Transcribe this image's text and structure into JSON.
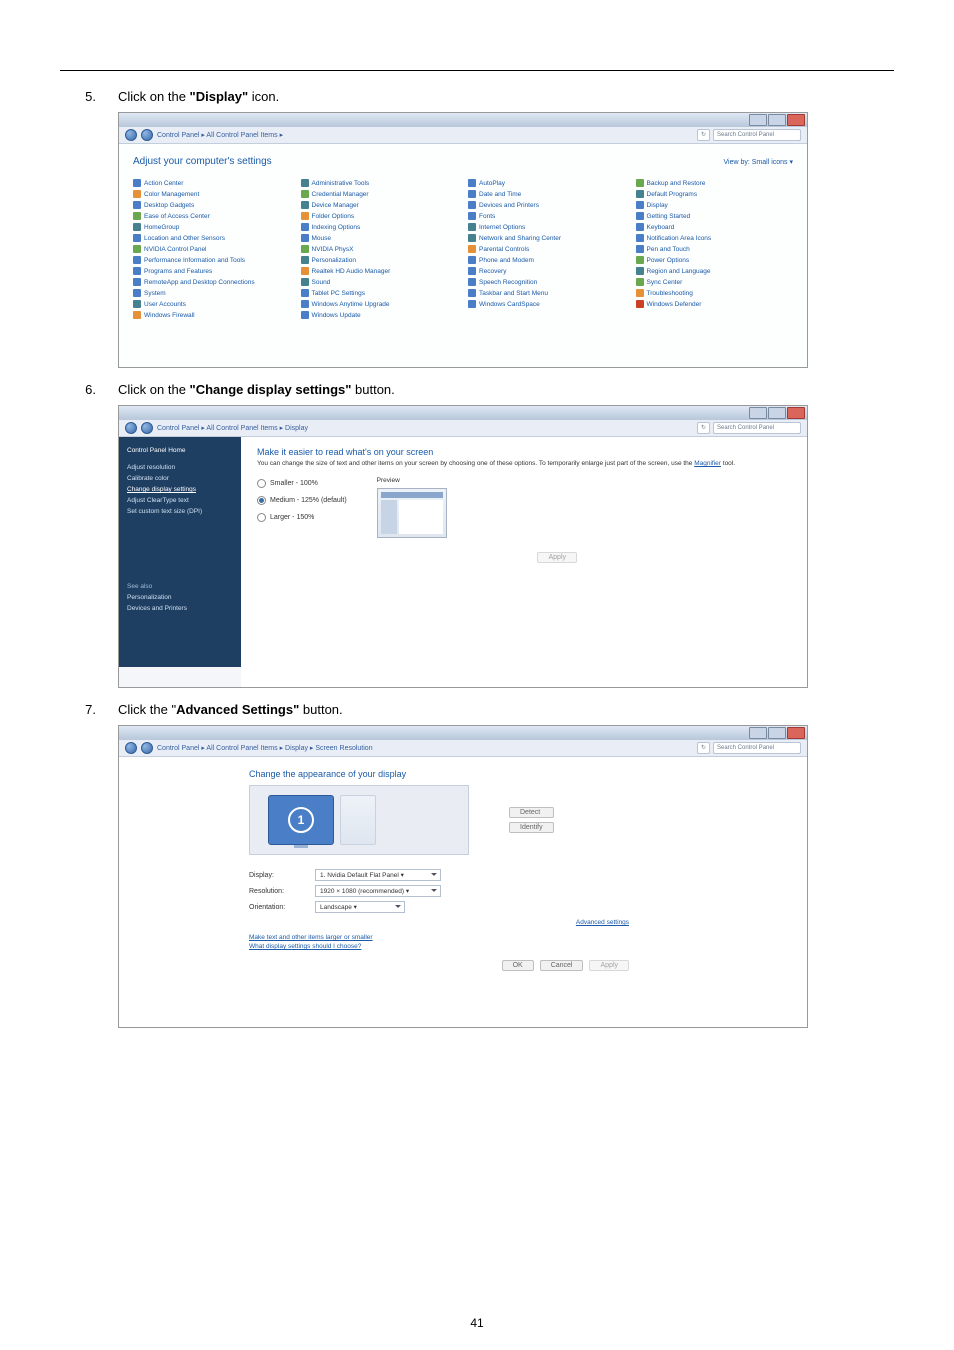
{
  "page_number": "41",
  "steps": {
    "s5": {
      "num": "5.",
      "pre": "Click on the ",
      "bold": "\"Display\"",
      "post": " icon."
    },
    "s6": {
      "num": "6.",
      "pre": "Click on the ",
      "bold": "\"Change display settings\"",
      "post": " button."
    },
    "s7": {
      "num": "7.",
      "pre": "Click the \"",
      "bold": "Advanced Settings\"",
      "post": " button."
    }
  },
  "win_common": {
    "search_placeholder": "Search Control Panel",
    "refresh_pill": "↻"
  },
  "shot1": {
    "breadcrumb": "Control Panel ▸ All Control Panel Items ▸",
    "heading": "Adjust your computer's settings",
    "viewby": "View by:  Small icons ▾",
    "items": [
      [
        {
          "t": "Action Center",
          "c": "blue"
        },
        {
          "t": "Administrative Tools",
          "c": "teal"
        },
        {
          "t": "AutoPlay",
          "c": "blue"
        },
        {
          "t": "Backup and Restore",
          "c": "green"
        }
      ],
      [
        {
          "t": "Color Management",
          "c": "orange"
        },
        {
          "t": "Credential Manager",
          "c": "green"
        },
        {
          "t": "Date and Time",
          "c": "blue"
        },
        {
          "t": "Default Programs",
          "c": "teal"
        }
      ],
      [
        {
          "t": "Desktop Gadgets",
          "c": "blue"
        },
        {
          "t": "Device Manager",
          "c": "teal"
        },
        {
          "t": "Devices and Printers",
          "c": "blue"
        },
        {
          "t": "Display",
          "c": "blue"
        }
      ],
      [
        {
          "t": "Ease of Access Center",
          "c": "green"
        },
        {
          "t": "Folder Options",
          "c": "orange"
        },
        {
          "t": "Fonts",
          "c": "blue"
        },
        {
          "t": "Getting Started",
          "c": "blue"
        }
      ],
      [
        {
          "t": "HomeGroup",
          "c": "teal"
        },
        {
          "t": "Indexing Options",
          "c": "blue"
        },
        {
          "t": "Internet Options",
          "c": "teal"
        },
        {
          "t": "Keyboard",
          "c": "blue"
        }
      ],
      [
        {
          "t": "Location and Other Sensors",
          "c": "blue"
        },
        {
          "t": "Mouse",
          "c": "blue"
        },
        {
          "t": "Network and Sharing Center",
          "c": "teal"
        },
        {
          "t": "Notification Area Icons",
          "c": "blue"
        }
      ],
      [
        {
          "t": "NVIDIA Control Panel",
          "c": "green"
        },
        {
          "t": "NVIDIA PhysX",
          "c": "green"
        },
        {
          "t": "Parental Controls",
          "c": "orange"
        },
        {
          "t": "Pen and Touch",
          "c": "blue"
        }
      ],
      [
        {
          "t": "Performance Information and Tools",
          "c": "blue"
        },
        {
          "t": "Personalization",
          "c": "teal"
        },
        {
          "t": "Phone and Modem",
          "c": "blue"
        },
        {
          "t": "Power Options",
          "c": "green"
        }
      ],
      [
        {
          "t": "Programs and Features",
          "c": "blue"
        },
        {
          "t": "Realtek HD Audio Manager",
          "c": "orange"
        },
        {
          "t": "Recovery",
          "c": "blue"
        },
        {
          "t": "Region and Language",
          "c": "teal"
        }
      ],
      [
        {
          "t": "RemoteApp and Desktop Connections",
          "c": "blue"
        },
        {
          "t": "Sound",
          "c": "teal"
        },
        {
          "t": "Speech Recognition",
          "c": "blue"
        },
        {
          "t": "Sync Center",
          "c": "green"
        }
      ],
      [
        {
          "t": "System",
          "c": "blue"
        },
        {
          "t": "Tablet PC Settings",
          "c": "blue"
        },
        {
          "t": "Taskbar and Start Menu",
          "c": "blue"
        },
        {
          "t": "Troubleshooting",
          "c": "orange"
        }
      ],
      [
        {
          "t": "User Accounts",
          "c": "teal"
        },
        {
          "t": "Windows Anytime Upgrade",
          "c": "blue"
        },
        {
          "t": "Windows CardSpace",
          "c": "blue"
        },
        {
          "t": "Windows Defender",
          "c": "red"
        }
      ],
      [
        {
          "t": "Windows Firewall",
          "c": "orange"
        },
        {
          "t": "Windows Update",
          "c": "blue"
        }
      ]
    ]
  },
  "shot2": {
    "breadcrumb": "Control Panel ▸ All Control Panel Items ▸ Display",
    "side": {
      "home": "Control Panel Home",
      "links": [
        "Adjust resolution",
        "Calibrate color",
        "Change display settings",
        "Adjust ClearType text",
        "Set custom text size (DPI)"
      ],
      "seealso": "See also",
      "sa_links": [
        "Personalization",
        "Devices and Printers"
      ]
    },
    "heading": "Make it easier to read what's on your screen",
    "sub_pre": "You can change the size of text and other items on your screen by choosing one of these options. To temporarily enlarge just part of the screen, use the ",
    "sub_link": "Magnifier",
    "sub_post": " tool.",
    "opts": {
      "o1": "Smaller - 100%",
      "o2": "Medium - 125% (default)",
      "o3": "Larger - 150%"
    },
    "preview": "Preview",
    "apply": "Apply"
  },
  "shot3": {
    "breadcrumb": "Control Panel ▸ All Control Panel Items ▸ Display ▸ Screen Resolution",
    "heading": "Change the appearance of your display",
    "detect": "Detect",
    "identify": "Identify",
    "monitor_num": "1",
    "display": {
      "k": "Display:",
      "v": "1. Nvidia Default Flat Panel ▾"
    },
    "resolution": {
      "k": "Resolution:",
      "v": "1920 × 1080 (recommended)  ▾"
    },
    "orientation": {
      "k": "Orientation:",
      "v": "Landscape            ▾"
    },
    "adv": "Advanced settings",
    "l1": "Make text and other items larger or smaller",
    "l2": "What display settings should I choose?",
    "ok": "OK",
    "cancel": "Cancel",
    "apply": "Apply"
  }
}
